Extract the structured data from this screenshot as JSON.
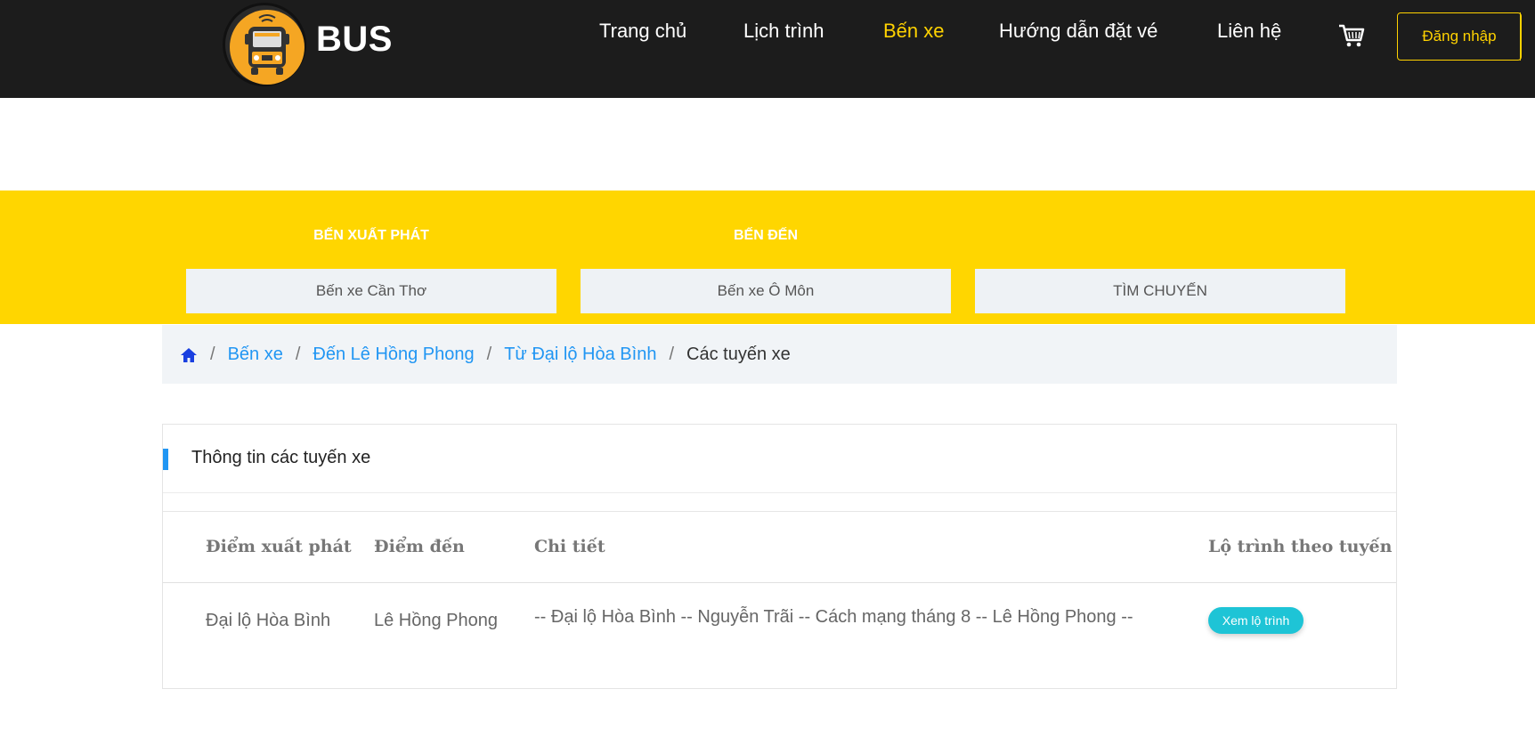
{
  "header": {
    "brand": "BUS",
    "nav": [
      "Trang chủ",
      "Lịch trình",
      "Bến xe",
      "Hướng dẫn đặt vé",
      "Liên hệ"
    ],
    "active_nav": "Bến xe",
    "login_label": "Đăng nhập",
    "icons": {
      "logo": "bus-logo-icon",
      "cart": "cart-icon"
    }
  },
  "search": {
    "from_label": "BẾN XUẤT PHÁT",
    "to_label": "BẾN ĐẾN",
    "from_value": "Bến xe Cần Thơ",
    "to_value": "Bến xe Ô Môn",
    "submit_label": "TÌM CHUYẾN"
  },
  "breadcrumb": {
    "home_icon": "home-icon",
    "items": [
      "Bến xe",
      "Đến Lê Hồng Phong",
      "Từ Đại lộ Hòa Bình"
    ],
    "current": "Các tuyến xe"
  },
  "routes": {
    "title": "Thông tin các tuyến xe",
    "columns": [
      "Điểm xuất phát",
      "Điểm đến",
      "Chi tiết",
      "Lộ trình theo tuyến"
    ],
    "rows": [
      {
        "from": "Đại lộ Hòa Bình",
        "to": "Lê Hồng Phong",
        "detail": "-- Đại lộ Hòa Bình -- Nguyễn Trãi -- Cách mạng tháng 8 -- Lê Hồng Phong --",
        "action_label": "Xem lộ trình"
      }
    ]
  },
  "colors": {
    "header_bg": "#1c1c1c",
    "accent_yellow": "#ffd600",
    "link_blue": "#2196f3",
    "button_teal": "#1ec4d6"
  }
}
